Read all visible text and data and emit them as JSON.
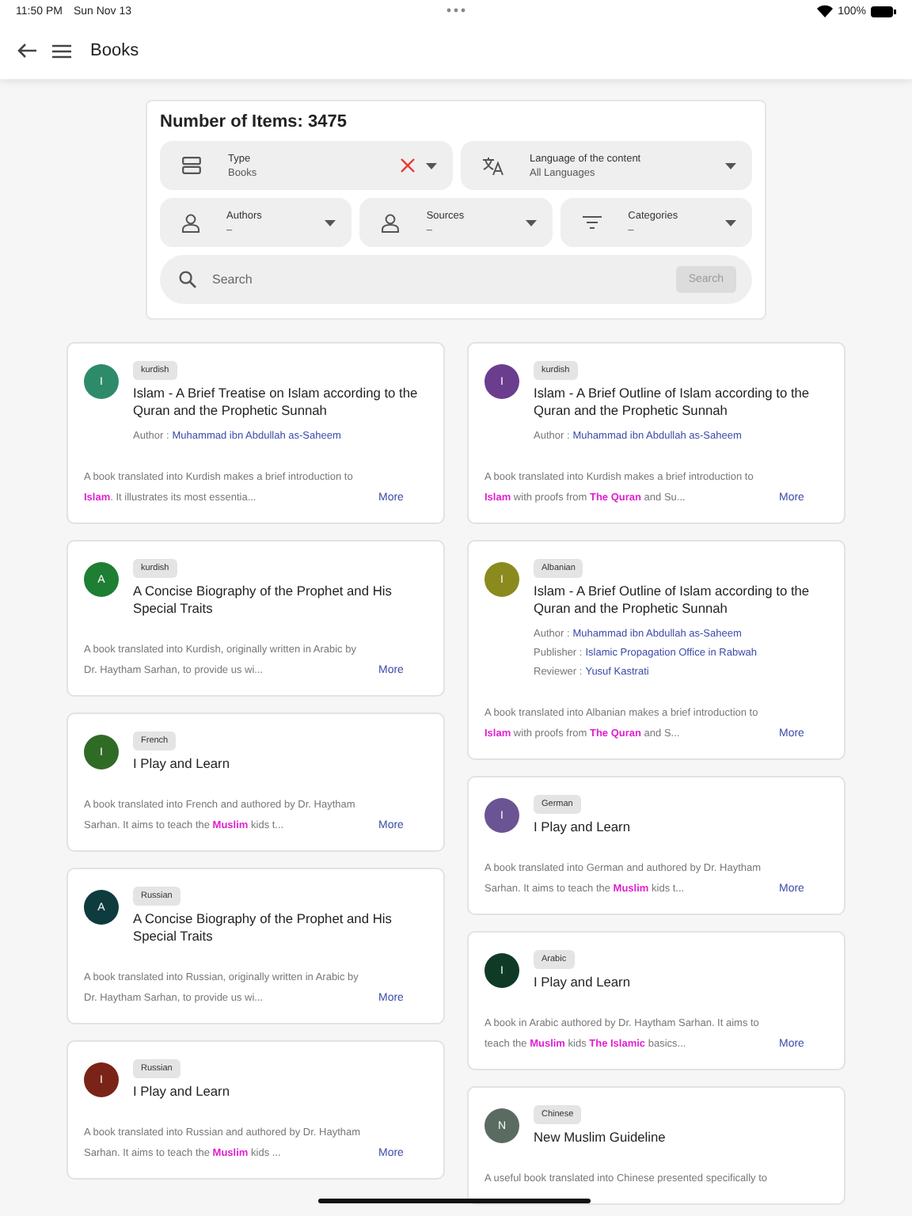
{
  "status_bar": {
    "time": "11:50 PM",
    "date": "Sun Nov 13",
    "battery": "100%"
  },
  "header": {
    "title": "Books"
  },
  "filters": {
    "count_label": "Number of Items: 3475",
    "row1": [
      {
        "kind": "type",
        "label": "Type",
        "value": "Books",
        "clearable": true
      },
      {
        "kind": "language",
        "label": "Language of the content",
        "value": "All Languages",
        "clearable": false
      }
    ],
    "row2": [
      {
        "kind": "person",
        "label": "Authors",
        "value": "–"
      },
      {
        "kind": "person",
        "label": "Sources",
        "value": "–"
      },
      {
        "kind": "filter",
        "label": "Categories",
        "value": "–"
      }
    ],
    "search": {
      "placeholder": "Search",
      "button": "Search"
    }
  },
  "columns": [
    [
      {
        "letter": "I",
        "color": "#2e8b6a",
        "language": "kurdish",
        "title": "Islam - A Brief Treatise on Islam according to the Quran and the Prophetic Sunnah",
        "credits": [
          {
            "label": "Author :",
            "value": "Muhammad ibn Abdullah as-Saheem"
          }
        ],
        "description": "A book translated into Kurdish makes a brief introduction to **Islam**. It illustrates its most essentia...",
        "more": "More"
      },
      {
        "letter": "A",
        "color": "#1e7e34",
        "language": "kurdish",
        "title": "A Concise Biography of the Prophet and His Special Traits",
        "description": "A book translated into Kurdish, originally written in Arabic by Dr. Haytham Sarhan, to provide us wi...",
        "more": "More"
      },
      {
        "letter": "I",
        "color": "#2f6b24",
        "language": "French",
        "title": "I Play and Learn",
        "description": "A book translated into French and authored by Dr. Haytham Sarhan. It aims to teach the **Muslim** kids t...",
        "more": "More"
      },
      {
        "letter": "A",
        "color": "#0d3b3e",
        "language": "Russian",
        "title": "A Concise Biography of the Prophet and His Special Traits",
        "description": "A book translated into Russian, originally written in Arabic by Dr. Haytham Sarhan, to provide us wi...",
        "more": "More"
      },
      {
        "letter": "I",
        "color": "#7a2418",
        "language": "Russian",
        "title": "I Play and Learn",
        "description": "A book translated into Russian and authored by Dr. Haytham Sarhan. It aims to teach the **Muslim** kids ...",
        "more": "More"
      }
    ],
    [
      {
        "letter": "I",
        "color": "#6a3d8f",
        "language": "kurdish",
        "title": "Islam - A Brief Outline of Islam according to the Quran and the Prophetic Sunnah",
        "credits": [
          {
            "label": "Author :",
            "value": "Muhammad ibn Abdullah as-Saheem"
          }
        ],
        "description": "A book translated into Kurdish makes a brief introduction to **Islam** with proofs from **The Quran** and Su...",
        "more": "More"
      },
      {
        "letter": "I",
        "color": "#8a8a1e",
        "language": "Albanian",
        "title": "Islam - A Brief Outline of Islam according to the Quran and the Prophetic Sunnah",
        "credits": [
          {
            "label": "Author :",
            "value": "Muhammad ibn Abdullah as-Saheem"
          },
          {
            "label": "Publisher :",
            "value": "Islamic Propagation Office in Rabwah"
          },
          {
            "label": "Reviewer :",
            "value": "Yusuf Kastrati"
          }
        ],
        "description": "A book translated into Albanian makes a brief introduction to **Islam** with proofs from **The Quran** and S...",
        "more": "More"
      },
      {
        "letter": "I",
        "color": "#6b5494",
        "language": "German",
        "title": "I Play and Learn",
        "description": "A book translated into German and authored by Dr. Haytham Sarhan. It aims to teach the **Muslim** kids t...",
        "more": "More"
      },
      {
        "letter": "I",
        "color": "#0f3b26",
        "language": "Arabic",
        "title": "I Play and Learn",
        "description": "A book in Arabic authored by Dr. Haytham Sarhan. It aims to teach the **Muslim** kids **The Islamic** basics...",
        "more": "More"
      },
      {
        "letter": "N",
        "color": "#5a6b62",
        "language": "Chinese",
        "title": "New Muslim Guideline",
        "description": "A useful book translated into Chinese presented specifically to"
      }
    ]
  ]
}
